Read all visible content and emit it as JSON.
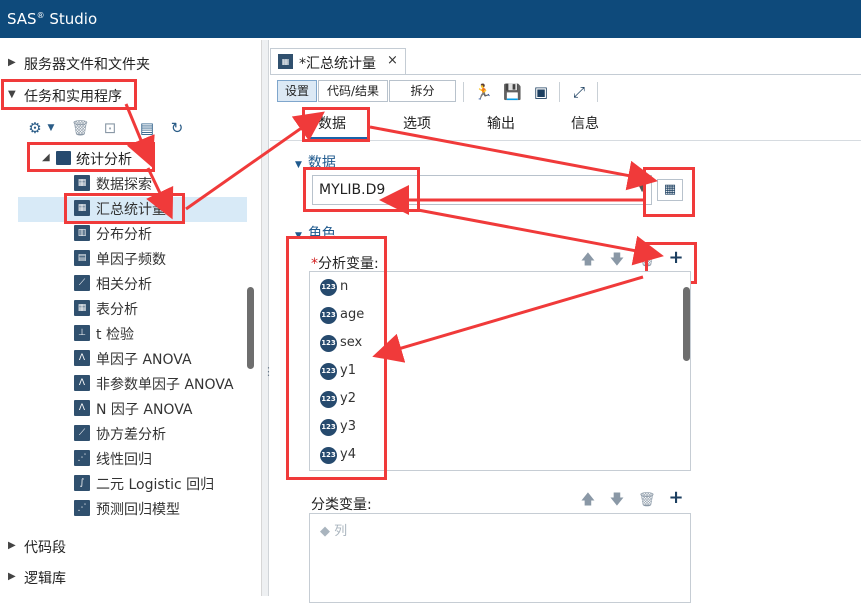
{
  "app": {
    "title_main": "SAS",
    "title_sup": "®",
    "title_rest": " Studio"
  },
  "colors": {
    "titlebar": "#0e4a7b",
    "accent": "#1b63a8",
    "annotation": "#f03a3a"
  },
  "nav": {
    "server_files": "服务器文件和文件夹",
    "tasks": "任务和实用程序",
    "snippets": "代码段",
    "libraries": "逻辑库"
  },
  "tree": {
    "folder": "统计分析",
    "items": [
      "数据探索",
      "汇总统计量",
      "分布分析",
      "单因子频数",
      "相关分析",
      "表分析",
      "t 检验",
      "单因子 ANOVA",
      "非参数单因子 ANOVA",
      "N 因子 ANOVA",
      "协方差分析",
      "线性回归",
      "二元 Logistic 回归",
      "预测回归模型"
    ],
    "selected_index": 1
  },
  "doc_tab": {
    "label": "*汇总统计量",
    "close": "×"
  },
  "view_modes": [
    "设置",
    "代码/结果",
    "拆分"
  ],
  "sub_tabs": [
    "数据",
    "选项",
    "输出",
    "信息"
  ],
  "data_section": {
    "heading": "数据",
    "dataset": "MYLIB.D9"
  },
  "roles_section": {
    "heading": "角色",
    "analysis_label": "分析变量:",
    "analysis_required": "*",
    "variables": [
      "n",
      "age",
      "sex",
      "y1",
      "y2",
      "y3",
      "y4"
    ],
    "numeric_badge": "123",
    "class_label": "分类变量:",
    "class_placeholder": "列"
  },
  "icons": {
    "run": "run-icon",
    "save": "save-icon",
    "save_as": "save-as-icon",
    "maximize": "maximize-icon",
    "add": "plus-icon",
    "delete": "trash-icon",
    "up": "arrow-up-icon",
    "down": "arrow-down-icon",
    "lib_picker": "table-picker-icon"
  }
}
